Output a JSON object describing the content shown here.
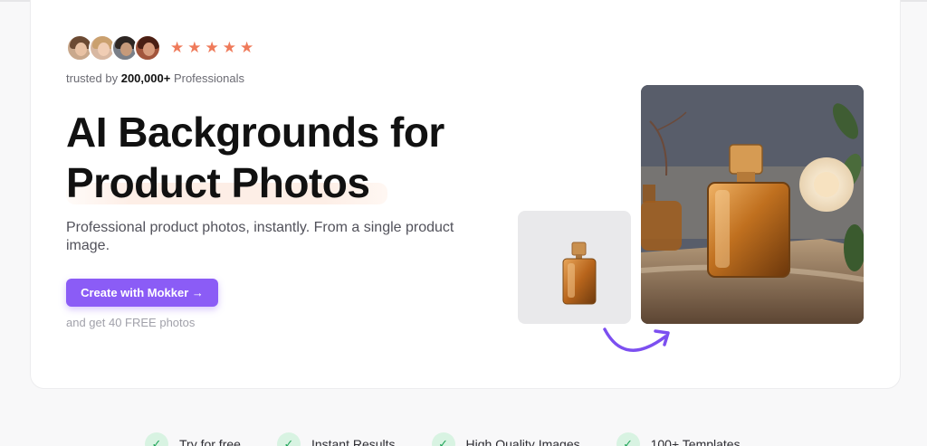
{
  "social_proof": {
    "avatar_count": 4,
    "rating_stars": 5,
    "trusted_prefix": "trusted by",
    "trusted_count": "200,000+",
    "trusted_suffix": "Professionals"
  },
  "hero": {
    "headline_line1": "AI Backgrounds for",
    "headline_line2": "Product Photos",
    "subtitle": "Professional product photos, instantly. From a single product image.",
    "cta_label": "Create with Mokker →",
    "cta_note": "and get 40 FREE photos"
  },
  "features": [
    {
      "label": "Try for free"
    },
    {
      "label": "Instant Results"
    },
    {
      "label": "High Quality Images"
    },
    {
      "label": "100+ Templates"
    }
  ],
  "colors": {
    "accent": "#8b5cf6",
    "star": "#ef7a5a",
    "highlight": "#fdeee6"
  },
  "icons": {
    "star": "star-icon",
    "check": "check-icon",
    "arrow": "curved-arrow-icon"
  }
}
